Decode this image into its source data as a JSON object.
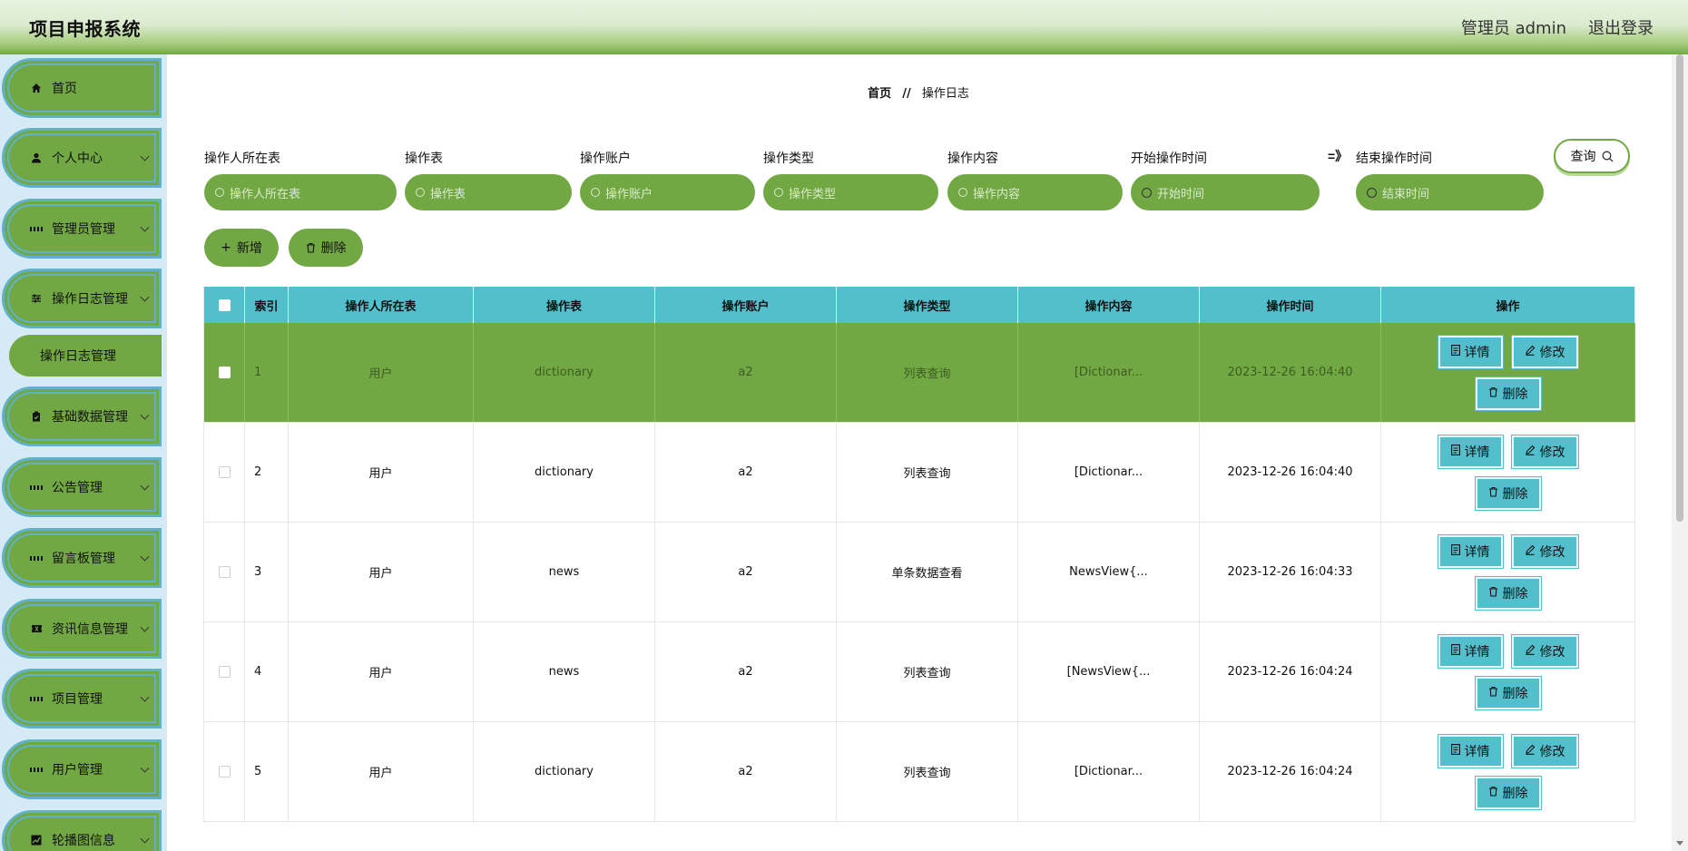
{
  "header": {
    "title": "项目申报系统",
    "user": "管理员 admin",
    "logout": "退出登录"
  },
  "sidebar": {
    "items": [
      {
        "label": "首页",
        "icon": "home-icon"
      },
      {
        "label": "个人中心",
        "icon": "user-icon"
      },
      {
        "label": "管理员管理",
        "icon": "grid-icon"
      },
      {
        "label": "操作日志管理",
        "icon": "sliders-icon"
      },
      {
        "label": "基础数据管理",
        "icon": "clipboard-icon"
      },
      {
        "label": "公告管理",
        "icon": "grid-icon"
      },
      {
        "label": "留言板管理",
        "icon": "grid-icon"
      },
      {
        "label": "资讯信息管理",
        "icon": "ticket-icon"
      },
      {
        "label": "项目管理",
        "icon": "grid-icon"
      },
      {
        "label": "用户管理",
        "icon": "grid-icon"
      },
      {
        "label": "轮播图信息",
        "icon": "chart-icon"
      }
    ],
    "sub_active": "操作日志管理"
  },
  "breadcrumb": {
    "home": "首页",
    "sep": "//",
    "current": "操作日志"
  },
  "filters": {
    "table_label": "操作人所在表",
    "table_placeholder": "操作人所在表",
    "op_table_label": "操作表",
    "op_table_placeholder": "操作表",
    "account_label": "操作账户",
    "account_placeholder": "操作账户",
    "type_label": "操作类型",
    "type_placeholder": "操作类型",
    "content_label": "操作内容",
    "content_placeholder": "操作内容",
    "start_label": "开始操作时间",
    "start_placeholder": "开始时间",
    "range_sep": "=》",
    "end_label": "结束操作时间",
    "end_placeholder": "结束时间",
    "search": "查询"
  },
  "actions": {
    "add": "新增",
    "delete": "删除"
  },
  "table": {
    "columns": [
      "索引",
      "操作人所在表",
      "操作表",
      "操作账户",
      "操作类型",
      "操作内容",
      "操作时间",
      "操作"
    ],
    "rows": [
      {
        "idx": "1",
        "user_table": "用户",
        "op_table": "dictionary",
        "account": "a2",
        "type": "列表查询",
        "content": "[Dictionar...",
        "time": "2023-12-26 16:04:40"
      },
      {
        "idx": "2",
        "user_table": "用户",
        "op_table": "dictionary",
        "account": "a2",
        "type": "列表查询",
        "content": "[Dictionar...",
        "time": "2023-12-26 16:04:40"
      },
      {
        "idx": "3",
        "user_table": "用户",
        "op_table": "news",
        "account": "a2",
        "type": "单条数据查看",
        "content": "NewsView{...",
        "time": "2023-12-26 16:04:33"
      },
      {
        "idx": "4",
        "user_table": "用户",
        "op_table": "news",
        "account": "a2",
        "type": "列表查询",
        "content": "[NewsView{...",
        "time": "2023-12-26 16:04:24"
      },
      {
        "idx": "5",
        "user_table": "用户",
        "op_table": "dictionary",
        "account": "a2",
        "type": "列表查询",
        "content": "[Dictionar...",
        "time": "2023-12-26 16:04:24"
      }
    ],
    "row_actions": {
      "detail": "详情",
      "edit": "修改",
      "delete": "删除"
    }
  },
  "colors": {
    "green": "#72a843",
    "teal": "#53bfcd",
    "sidebar_bg": "#d6eaf5"
  }
}
